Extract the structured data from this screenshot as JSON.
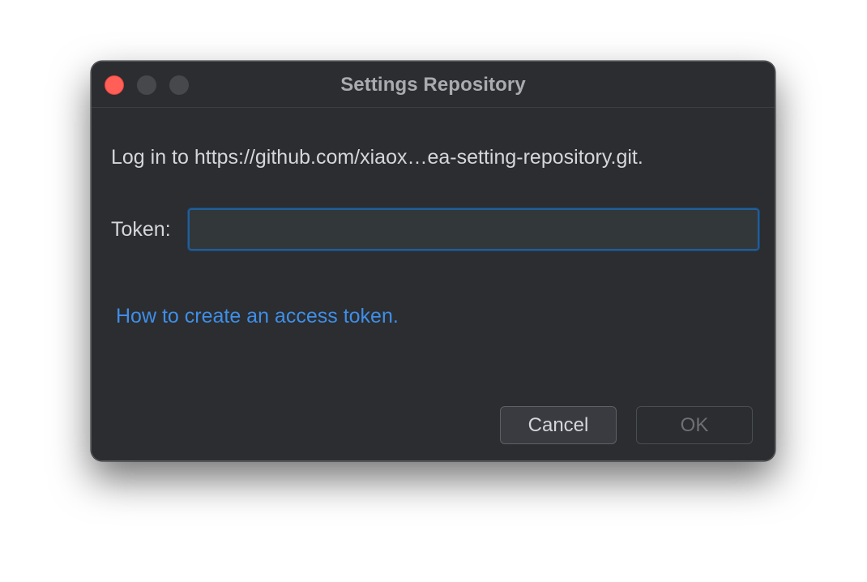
{
  "window": {
    "title": "Settings Repository"
  },
  "dialog": {
    "message": "Log in to https://github.com/xiaox…ea-setting-repository.git.",
    "token_label": "Token:",
    "token_value": "",
    "help_link": "How to create an access token."
  },
  "buttons": {
    "cancel_label": "Cancel",
    "ok_label": "OK",
    "ok_enabled": false
  },
  "colors": {
    "background": "#2b2d30",
    "link": "#3f8ee8",
    "input_focus_border": "#245d98",
    "close_button": "#ff5f57"
  }
}
